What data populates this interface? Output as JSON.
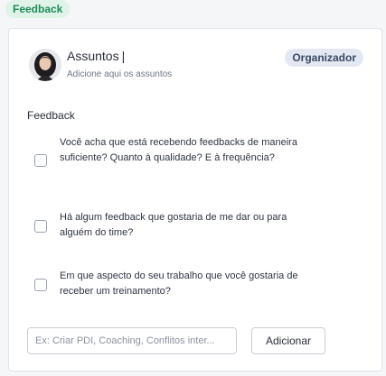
{
  "header": {
    "badge_label": "Feedback"
  },
  "card": {
    "subject_title": "Assuntos",
    "subject_cursor": "|",
    "subject_hint": "Adicione aqui os assuntos",
    "role_badge": "Organizador",
    "section_label": "Feedback",
    "questions": [
      {
        "text": "Você acha que está recebendo feedbacks de maneira suficiente? Quanto à qualidade? E à frequência?",
        "checked": false
      },
      {
        "text": "Há algum feedback que gostaria de me dar ou para alguém do time?",
        "checked": false
      },
      {
        "text": "Em que aspecto do seu trabalho que você gostaria de receber um treinamento?",
        "checked": false
      }
    ],
    "add_input_placeholder": "Ex: Criar PDI, Coaching, Conflitos inter...",
    "add_input_value": "",
    "add_button_label": "Adicionar"
  },
  "colors": {
    "badge_bg": "#dff3e9",
    "badge_text": "#1f8a5a",
    "role_bg": "#e3e8f2",
    "role_text": "#3b4a63"
  }
}
